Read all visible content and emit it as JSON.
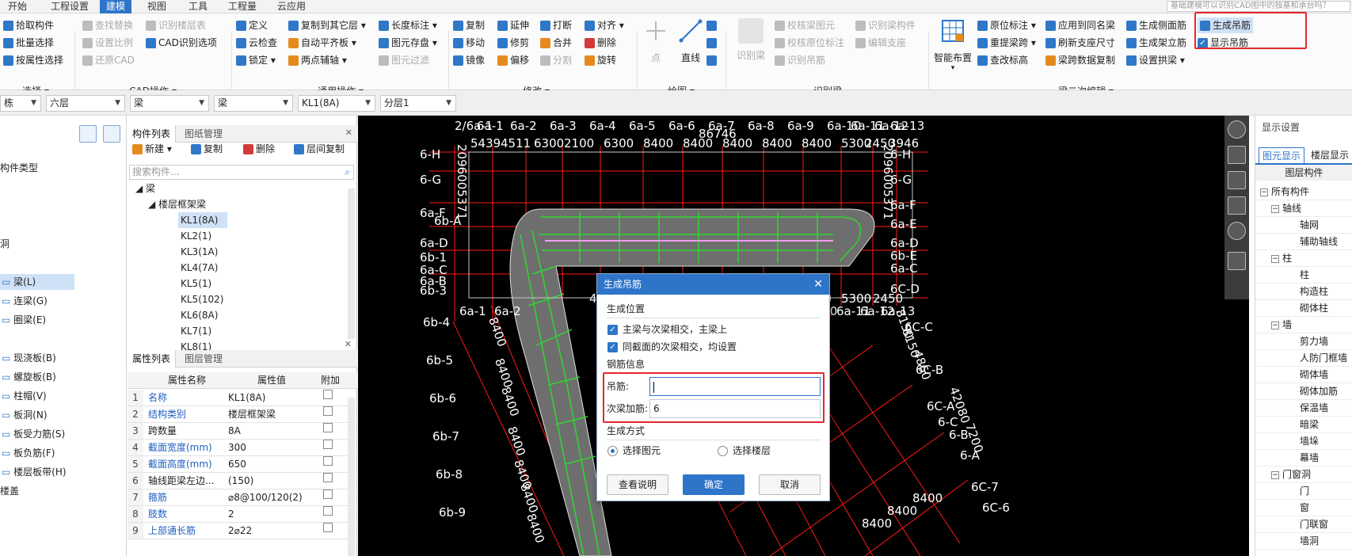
{
  "menu": {
    "tabs": [
      "开始",
      "工程设置",
      "建模",
      "视图",
      "工具",
      "工程量",
      "云应用"
    ],
    "active": "建模",
    "tip": "基础建模可以识别CAD图中的独基和承台吗？"
  },
  "ribbon": {
    "select": {
      "items": [
        "拾取构件",
        "批量选择",
        "按属性选择"
      ],
      "group": "选择"
    },
    "cad": {
      "items": [
        "查找替换",
        "设置比例",
        "还原CAD",
        "识别楼层表",
        "CAD识别选项"
      ],
      "group": "CAD操作"
    },
    "general": {
      "items": [
        "定义",
        "云检查",
        "锁定",
        "复制到其它层",
        "自动平齐板",
        "两点辅轴",
        "长度标注",
        "图元存盘",
        "图元过滤"
      ],
      "group": "通用操作"
    },
    "modify": {
      "items": [
        "复制",
        "移动",
        "镜像",
        "延伸",
        "修剪",
        "偏移",
        "打断",
        "合并",
        "分割",
        "对齐",
        "删除",
        "旋转"
      ],
      "group": "修改"
    },
    "draw": {
      "items": [
        "点",
        "直线"
      ],
      "group": "绘图"
    },
    "recog": {
      "items": [
        "识别梁",
        "校核梁图元",
        "校核原位标注",
        "识别吊筋",
        "识别梁构件",
        "编辑支座"
      ],
      "group": "识别梁"
    },
    "beam2": {
      "items": [
        "智能布置",
        "原位标注",
        "重提梁跨",
        "查改标高",
        "应用到同名梁",
        "刷新支座尺寸",
        "梁跨数据复制",
        "生成侧面筋",
        "生成架立筋",
        "设置拱梁",
        "生成吊筋",
        "显示吊筋"
      ],
      "group": "梁二次编辑"
    }
  },
  "selectors": [
    "栋",
    "六层",
    "梁",
    "梁",
    "KL1(8A)",
    "分层1"
  ],
  "left_panel": {
    "header": "构件类型",
    "items": [
      "洞",
      "梁(L)",
      "连梁(G)",
      "圈梁(E)",
      "现浇板(B)",
      "螺旋板(B)",
      "柱帽(V)",
      "板洞(N)",
      "板受力筋(S)",
      "板负筋(F)",
      "楼层板带(H)",
      "楼盖"
    ],
    "selected": "梁(L)"
  },
  "component_list": {
    "tabs": [
      "构件列表",
      "图纸管理"
    ],
    "toolbar": [
      "新建",
      "复制",
      "删除",
      "层间复制"
    ],
    "search_placeholder": "搜索构件...",
    "tree_root": "梁",
    "tree_group": "楼层框架梁",
    "items": [
      "KL1(8A)",
      "KL2(1)",
      "KL3(1A)",
      "KL4(7A)",
      "KL5(1)",
      "KL5(102)",
      "KL6(8A)",
      "KL7(1)",
      "KL8(1)"
    ],
    "selected": "KL1(8A)"
  },
  "property_list": {
    "tabs": [
      "属性列表",
      "图层管理"
    ],
    "headers": [
      "属性名称",
      "属性值",
      "附加"
    ],
    "rows": [
      {
        "num": "1",
        "name": "名称",
        "value": "KL1(8A)"
      },
      {
        "num": "2",
        "name": "结构类别",
        "value": "楼层框架梁"
      },
      {
        "num": "3",
        "name": "跨数量",
        "value": "8A"
      },
      {
        "num": "4",
        "name": "截面宽度(mm)",
        "value": "300"
      },
      {
        "num": "5",
        "name": "截面高度(mm)",
        "value": "650"
      },
      {
        "num": "6",
        "name": "轴线距梁左边...",
        "value": "(150)"
      },
      {
        "num": "7",
        "name": "箍筋",
        "value": "⌀8@100/120(2)"
      },
      {
        "num": "8",
        "name": "肢数",
        "value": "2"
      },
      {
        "num": "9",
        "name": "上部通长筋",
        "value": "2⌀22"
      }
    ]
  },
  "cad_labels": {
    "top_axes": [
      "2/6a-1",
      "6a-1",
      "6a-2",
      "6a-3",
      "6a-4",
      "6a-5",
      "6a-6",
      "6a-7",
      "6a-8",
      "6a-9",
      "6a-10",
      "6a-11",
      "6a-12",
      "6a-13"
    ],
    "top_dims": [
      "5439",
      "4511",
      "6300",
      "2100",
      "6300",
      "8400",
      "8400",
      "8400",
      "8400",
      "8400",
      "5300",
      "2450",
      "3946"
    ],
    "extra_dim": "86746",
    "left_rows": [
      "6-H",
      "6-G",
      "6a-F",
      "6b-A",
      "6a-D",
      "6b-1",
      "6a-C",
      "6a-B",
      "6b-3",
      "6b-4",
      "6b-5",
      "6b-6",
      "6b-7",
      "6b-8",
      "6b-9"
    ],
    "right_rows": [
      "6-H",
      "6-G",
      "6a-F",
      "6a-E",
      "6a-D",
      "6b-E",
      "6a-C",
      "6C-D",
      "6C-C",
      "6C-B",
      "6C-A",
      "6-C",
      "6-B",
      "6-A",
      "6C-7",
      "6C-6"
    ],
    "left_vert": "2096005371",
    "right_vert": "2096005371",
    "mid_dims": [
      "4511",
      "6300",
      "2100",
      "8400",
      "5300",
      "2450"
    ],
    "mid_axes": [
      "6a-1",
      "6a-2",
      "6a-10",
      "6a-11",
      "6a-12",
      "6a-13"
    ],
    "diag_dims": [
      "8400",
      "8400",
      "8400",
      "8400",
      "8400",
      "8400",
      "8400"
    ],
    "right_diag": [
      "8150",
      "8150",
      "4860",
      "42080",
      "7200"
    ],
    "bottom_dims": [
      "8400",
      "8400",
      "8400"
    ]
  },
  "right_panel": {
    "header": "显示设置",
    "tabs": [
      "图元显示",
      "楼层显示"
    ],
    "column": "图层构件",
    "tree": [
      {
        "label": "所有构件",
        "level": 0,
        "toggle": "−"
      },
      {
        "label": "轴线",
        "level": 1,
        "toggle": "−"
      },
      {
        "label": "轴网",
        "level": 2
      },
      {
        "label": "辅助轴线",
        "level": 2
      },
      {
        "label": "柱",
        "level": 1,
        "toggle": "−"
      },
      {
        "label": "柱",
        "level": 2
      },
      {
        "label": "构造柱",
        "level": 2
      },
      {
        "label": "砌体柱",
        "level": 2
      },
      {
        "label": "墙",
        "level": 1,
        "toggle": "−"
      },
      {
        "label": "剪力墙",
        "level": 2
      },
      {
        "label": "人防门框墙",
        "level": 2
      },
      {
        "label": "砌体墙",
        "level": 2
      },
      {
        "label": "砌体加筋",
        "level": 2
      },
      {
        "label": "保温墙",
        "level": 2
      },
      {
        "label": "暗梁",
        "level": 2
      },
      {
        "label": "墙垛",
        "level": 2
      },
      {
        "label": "幕墙",
        "level": 2
      },
      {
        "label": "门窗洞",
        "level": 1,
        "toggle": "−"
      },
      {
        "label": "门",
        "level": 2
      },
      {
        "label": "窗",
        "level": 2
      },
      {
        "label": "门联窗",
        "level": 2
      },
      {
        "label": "墙洞",
        "level": 2
      }
    ]
  },
  "dialog": {
    "title": "生成吊筋",
    "position_title": "生成位置",
    "check1": "主梁与次梁相交，主梁上",
    "check2": "同截面的次梁相交，均设置",
    "rebar_title": "钢筋信息",
    "hanger_label": "吊筋:",
    "hanger_value": "",
    "secondary_label": "次梁加筋:",
    "secondary_value": "6",
    "method_title": "生成方式",
    "radio1": "选择图元",
    "radio2": "选择楼层",
    "btn_help": "查看说明",
    "btn_ok": "确定",
    "btn_cancel": "取消"
  },
  "colors": {
    "accent": "#2e75c9",
    "highlight": "#e5272d",
    "cad_bg": "#000000",
    "grid": "#ff1a1a",
    "beam_fill": "#6e6e6e",
    "green": "#31d631"
  }
}
